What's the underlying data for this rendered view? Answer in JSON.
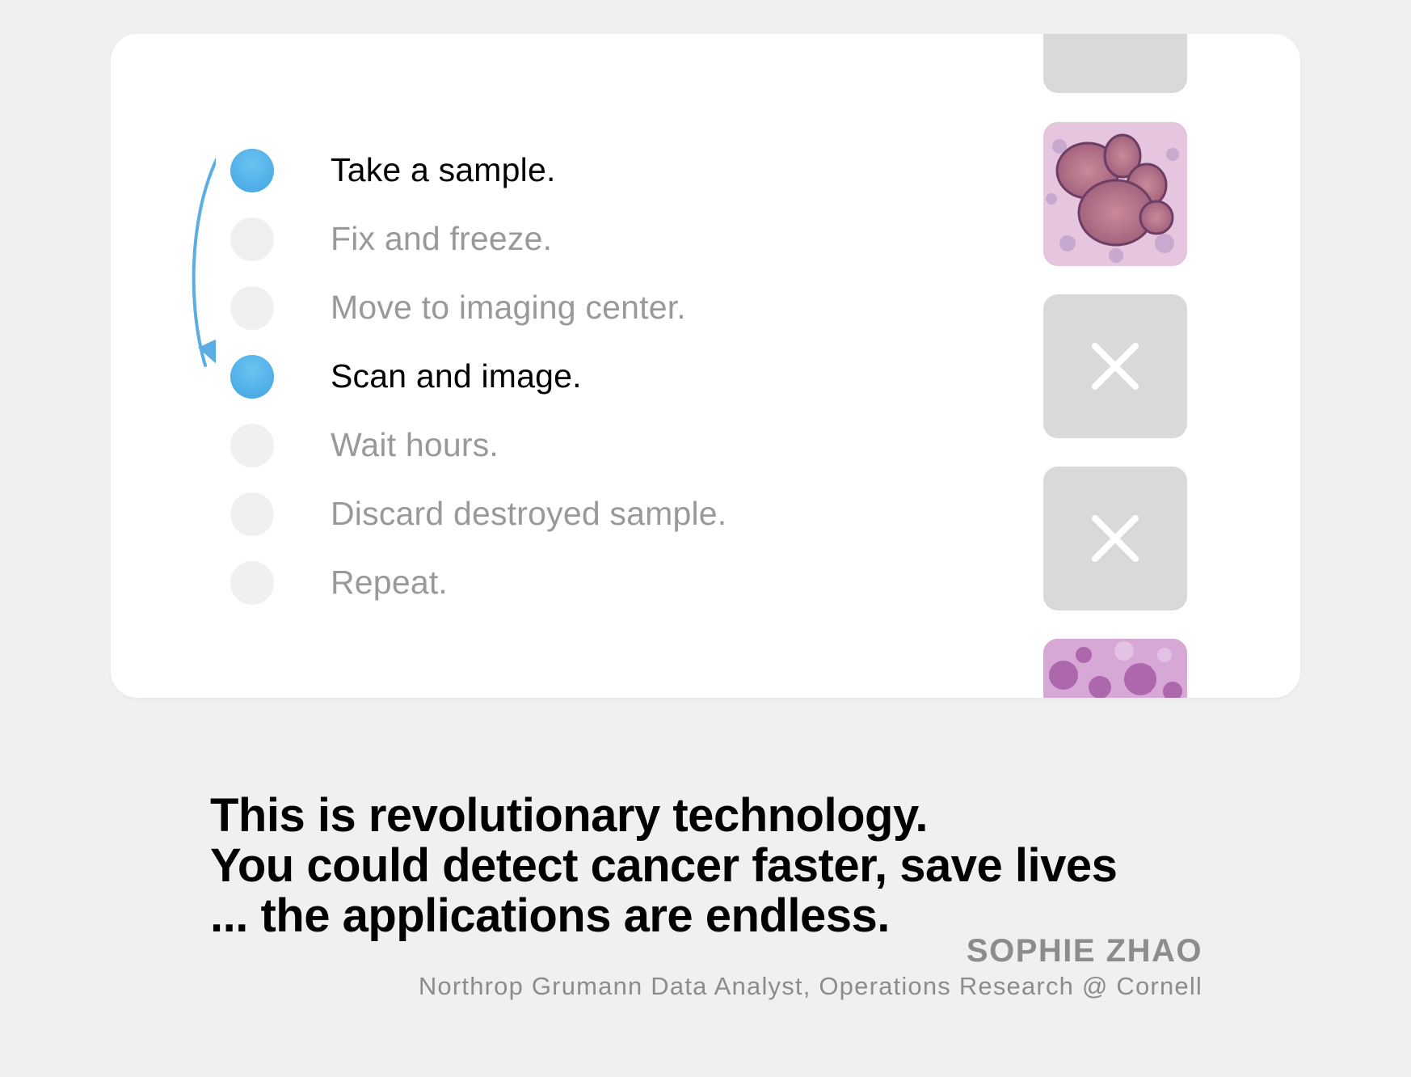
{
  "steps": [
    {
      "label": "Take a sample.",
      "active": true
    },
    {
      "label": "Fix and freeze.",
      "active": false
    },
    {
      "label": "Move to imaging center.",
      "active": false
    },
    {
      "label": "Scan and image.",
      "active": true
    },
    {
      "label": "Wait hours.",
      "active": false
    },
    {
      "label": "Discard destroyed sample.",
      "active": false
    },
    {
      "label": "Repeat.",
      "active": false
    }
  ],
  "thumbnails": [
    {
      "kind": "placeholder"
    },
    {
      "kind": "tissue-image"
    },
    {
      "kind": "close-icon"
    },
    {
      "kind": "close-icon"
    },
    {
      "kind": "tissue-image"
    }
  ],
  "quote": {
    "line1": "This is revolutionary technology.",
    "line2": "You could detect cancer faster, save lives",
    "line3": "... the applications are endless."
  },
  "author": {
    "name": "SOPHIE ZHAO",
    "title": "Northrop Grumann Data Analyst, Operations Research @ Cornell"
  },
  "colors": {
    "accent": "#41a4e2",
    "inactive_dot": "#f0f0f0",
    "inactive_text": "#999999",
    "background": "#f0f0f0"
  }
}
